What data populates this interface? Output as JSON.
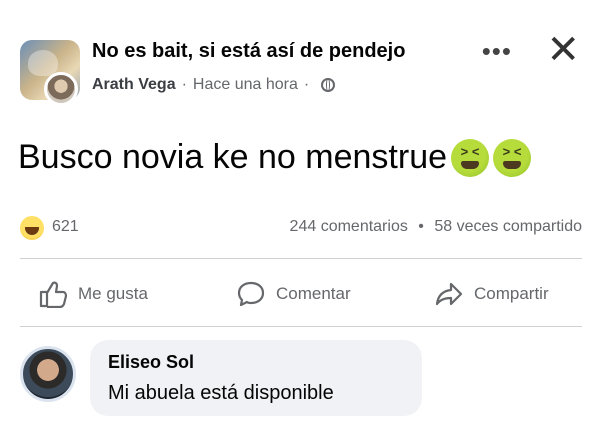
{
  "post": {
    "group_name": "No es bait, si está así de pendejo",
    "author": "Arath Vega",
    "time": "Hace una hora",
    "separator": "·",
    "text": "Busco novia ke no menstrue",
    "emojis": [
      "nauseated-face",
      "nauseated-face"
    ]
  },
  "stats": {
    "reaction_icon": "haha-reaction-icon",
    "reaction_count": "621",
    "comments": "244 comentarios",
    "separator": "•",
    "shares": "58 veces compartido"
  },
  "actions": {
    "like_label": "Me gusta",
    "comment_label": "Comentar",
    "share_label": "Compartir"
  },
  "comment": {
    "author": "Eliseo Sol",
    "text": "Mi abuela está disponible"
  },
  "colors": {
    "text_primary": "#050505",
    "text_secondary": "#65676b",
    "bubble_bg": "#f0f2f5",
    "divider": "#ced0d4"
  }
}
